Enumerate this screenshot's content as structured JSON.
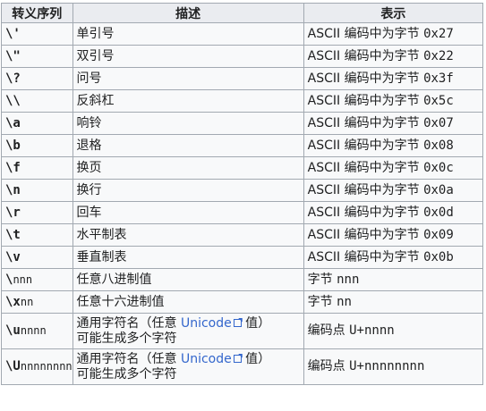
{
  "headers": [
    "转义序列",
    "描述",
    "表示"
  ],
  "rows": [
    {
      "seq": "\\'",
      "desc": "单引号",
      "rep_text": "ASCII 编码中为字节 ",
      "rep_code": "0x27"
    },
    {
      "seq": "\\\"",
      "desc": "双引号",
      "rep_text": "ASCII 编码中为字节 ",
      "rep_code": "0x22"
    },
    {
      "seq": "\\?",
      "desc": "问号",
      "rep_text": "ASCII 编码中为字节 ",
      "rep_code": "0x3f"
    },
    {
      "seq": "\\\\",
      "desc": "反斜杠",
      "rep_text": "ASCII 编码中为字节 ",
      "rep_code": "0x5c"
    },
    {
      "seq": "\\a",
      "desc": "响铃",
      "rep_text": "ASCII 编码中为字节 ",
      "rep_code": "0x07"
    },
    {
      "seq": "\\b",
      "desc": "退格",
      "rep_text": "ASCII 编码中为字节 ",
      "rep_code": "0x08"
    },
    {
      "seq": "\\f",
      "desc": "换页",
      "rep_text": "ASCII 编码中为字节 ",
      "rep_code": "0x0c"
    },
    {
      "seq": "\\n",
      "desc": "换行",
      "rep_text": "ASCII 编码中为字节 ",
      "rep_code": "0x0a"
    },
    {
      "seq": "\\r",
      "desc": "回车",
      "rep_text": "ASCII 编码中为字节 ",
      "rep_code": "0x0d"
    },
    {
      "seq": "\\t",
      "desc": "水平制表",
      "rep_text": "ASCII 编码中为字节 ",
      "rep_code": "0x09"
    },
    {
      "seq": "\\v",
      "desc": "垂直制表",
      "rep_text": "ASCII 编码中为字节 ",
      "rep_code": "0x0b"
    }
  ],
  "numeric_rows": [
    {
      "seq_prefix": "\\",
      "seq_placeholder": "nnn",
      "desc": "任意八进制值",
      "rep_text": "字节 ",
      "rep_code": "nnn"
    },
    {
      "seq_prefix": "\\x",
      "seq_placeholder": "nn",
      "desc": "任意十六进制值",
      "rep_text": "字节 ",
      "rep_code": "nn"
    }
  ],
  "unicode_rows": [
    {
      "seq_prefix": "\\u",
      "seq_placeholder": "nnnn",
      "desc_before": "通用字符名（任意 ",
      "link": "Unicode",
      "desc_after": " 值）",
      "desc_line2": "可能生成多个字符",
      "rep_text": "编码点 ",
      "rep_code": "U+nnnn"
    },
    {
      "seq_prefix": "\\U",
      "seq_placeholder": "nnnnnnnn",
      "desc_before": "通用字符名（任意 ",
      "link": "Unicode",
      "desc_after": " 值）",
      "desc_line2": "可能生成多个字符",
      "rep_text": "编码点 ",
      "rep_code": "U+nnnnnnnn"
    }
  ],
  "colors": {
    "header_bg": "#eaecf0",
    "cell_bg": "#f8f9fa",
    "border": "#a2a9b1",
    "link": "#3366cc"
  },
  "icons": {
    "external_link": "external-link-icon"
  }
}
